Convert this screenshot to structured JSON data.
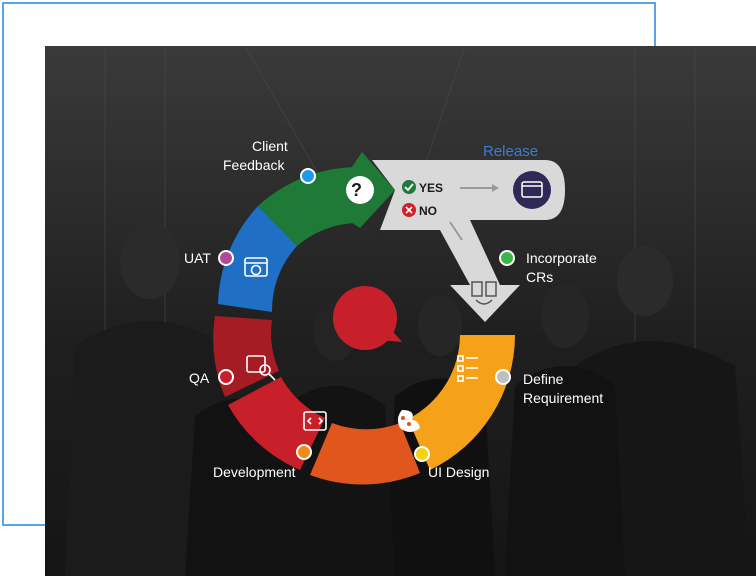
{
  "stages": {
    "client_feedback_line1": "Client",
    "client_feedback_line2": "Feedback",
    "release": "Release",
    "incorporate_line1": "Incorporate",
    "incorporate_line2": "CRs",
    "define_line1": "Define",
    "define_line2": "Requirement",
    "ui_design": "UI Design",
    "development": "Development",
    "qa": "QA",
    "uat": "UAT"
  },
  "decision": {
    "question_mark": "?",
    "yes": "YES",
    "no": "NO"
  },
  "colors": {
    "frame": "#5aa3e6",
    "green": "#1f7a38",
    "blue": "#1f6fc4",
    "red": "#c8202a",
    "dark_red": "#a51c24",
    "orange": "#e0561c",
    "yellow": "#f5a21a",
    "grey": "#d9d9d9",
    "release_text": "#3a7bd5"
  },
  "icons": [
    "question-icon",
    "check-icon",
    "cross-icon",
    "release-window-icon",
    "documents-swap-icon",
    "checklist-icon",
    "palette-icon",
    "code-icon",
    "search-code-icon",
    "globe-window-icon",
    "chat-bubble-icon"
  ]
}
